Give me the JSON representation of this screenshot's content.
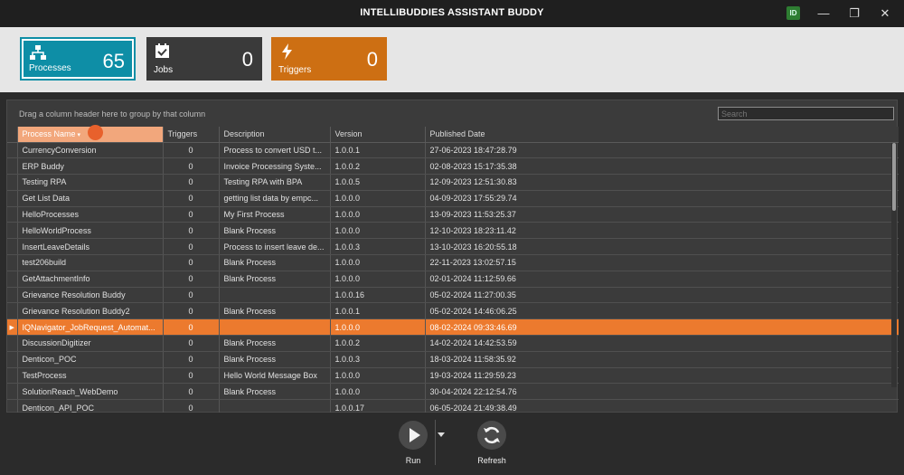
{
  "window": {
    "title": "INTELLIBUDDIES ASSISTANT BUDDY",
    "user_initials": "ID",
    "minimize": "—",
    "restore": "❐",
    "close": "✕"
  },
  "cards": [
    {
      "label": "Processes",
      "count": "65",
      "icon": "sitemap-icon",
      "color": "#0e8ea6"
    },
    {
      "label": "Jobs",
      "count": "0",
      "icon": "calendar-check-icon",
      "color": "#3a3a3a"
    },
    {
      "label": "Triggers",
      "count": "0",
      "icon": "lightning-icon",
      "color": "#cd6f13"
    }
  ],
  "grid": {
    "group_hint": "Drag a column header here to group by that column",
    "search_placeholder": "Search",
    "columns": [
      "Process Name",
      "Triggers",
      "Description",
      "Version",
      "Published Date"
    ],
    "rows": [
      [
        "CurrencyConversion",
        "0",
        "Process to convert USD t...",
        "1.0.0.1",
        "27-06-2023 18:47:28.79"
      ],
      [
        "ERP Buddy",
        "0",
        "Invoice Processing Syste...",
        "1.0.0.2",
        "02-08-2023 15:17:35.38"
      ],
      [
        "Testing RPA",
        "0",
        "Testing RPA with BPA",
        "1.0.0.5",
        "12-09-2023 12:51:30.83"
      ],
      [
        "Get List Data",
        "0",
        "getting list data by empc...",
        "1.0.0.0",
        "04-09-2023 17:55:29.74"
      ],
      [
        "HelloProcesses",
        "0",
        "My First Process",
        "1.0.0.0",
        "13-09-2023 11:53:25.37"
      ],
      [
        "HelloWorldProcess",
        "0",
        "Blank Process",
        "1.0.0.0",
        "12-10-2023 18:23:11.42"
      ],
      [
        "InsertLeaveDetails",
        "0",
        "Process to insert leave de...",
        "1.0.0.3",
        "13-10-2023 16:20:55.18"
      ],
      [
        "test206build",
        "0",
        "Blank Process",
        "1.0.0.0",
        "22-11-2023 13:02:57.15"
      ],
      [
        "GetAttachmentInfo",
        "0",
        "Blank Process",
        "1.0.0.0",
        "02-01-2024 11:12:59.66"
      ],
      [
        "Grievance Resolution Buddy",
        "0",
        "",
        "1.0.0.16",
        "05-02-2024 11:27:00.35"
      ],
      [
        "Grievance Resolution Buddy2",
        "0",
        "Blank Process",
        "1.0.0.1",
        "05-02-2024 14:46:06.25"
      ],
      [
        "IQNavigator_JobRequest_Automat...",
        "0",
        "",
        "1.0.0.0",
        "08-02-2024 09:33:46.69"
      ],
      [
        "DiscussionDigitizer",
        "0",
        "Blank Process",
        "1.0.0.2",
        "14-02-2024 14:42:53.59"
      ],
      [
        "Denticon_POC",
        "0",
        "Blank Process",
        "1.0.0.3",
        "18-03-2024 11:58:35.92"
      ],
      [
        "TestProcess",
        "0",
        "Hello World Message Box",
        "1.0.0.0",
        "19-03-2024 11:29:59.23"
      ],
      [
        "SolutionReach_WebDemo",
        "0",
        "Blank Process",
        "1.0.0.0",
        "30-04-2024 22:12:54.76"
      ],
      [
        "Denticon_API_POC",
        "0",
        "",
        "1.0.0.17",
        "06-05-2024 21:49:38.49"
      ]
    ],
    "selected_row_index": 11,
    "selected_indicator": "▶",
    "selected_color": "#ec7a2e",
    "sorted_header_color": "#f2a77c"
  },
  "actions": {
    "run_label": "Run",
    "refresh_label": "Refresh"
  }
}
